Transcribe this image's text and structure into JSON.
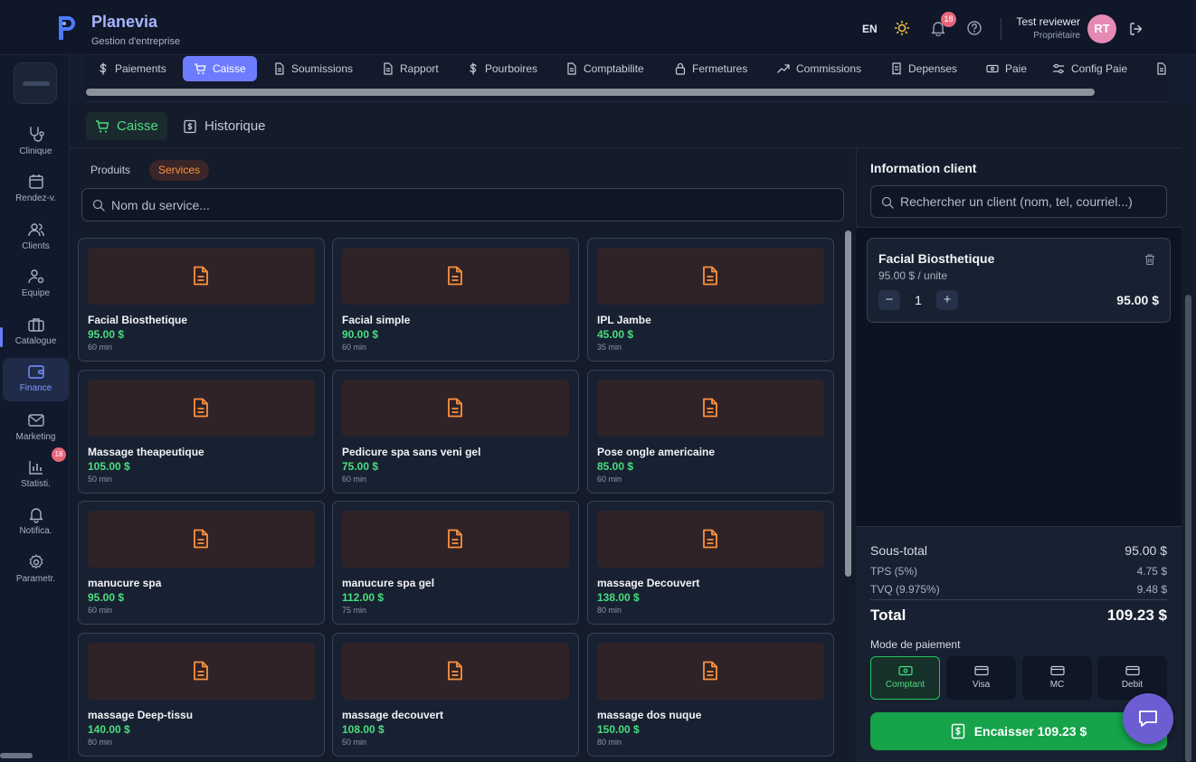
{
  "header": {
    "app_name": "Planevia",
    "app_subtitle": "Gestion d'entreprise",
    "language": "EN",
    "notification_count": "18",
    "user_name": "Test reviewer",
    "user_role": "Propriétaire",
    "user_initials": "RT"
  },
  "sidebar": {
    "items": [
      {
        "label": "Clinique",
        "icon": "stethoscope-icon"
      },
      {
        "label": "Rendez-v.",
        "icon": "calendar-icon"
      },
      {
        "label": "Clients",
        "icon": "users-icon"
      },
      {
        "label": "Equipe",
        "icon": "user-cog-icon"
      },
      {
        "label": "Catalogue",
        "icon": "briefcase-icon"
      },
      {
        "label": "Finance",
        "icon": "wallet-icon"
      },
      {
        "label": "Marketing",
        "icon": "mail-icon"
      },
      {
        "label": "Statisti.",
        "icon": "bar-chart-icon"
      },
      {
        "label": "Notifica.",
        "icon": "bell-icon"
      },
      {
        "label": "Parametr.",
        "icon": "gear-icon"
      }
    ],
    "notification_badge": "18"
  },
  "module_tabs": [
    {
      "label": "Paiements",
      "icon": "dollar-icon"
    },
    {
      "label": "Caisse",
      "icon": "cart-icon"
    },
    {
      "label": "Soumissions",
      "icon": "file-icon"
    },
    {
      "label": "Rapport",
      "icon": "file-icon"
    },
    {
      "label": "Pourboires",
      "icon": "dollar-icon"
    },
    {
      "label": "Comptabilite",
      "icon": "file-icon"
    },
    {
      "label": "Fermetures",
      "icon": "lock-icon"
    },
    {
      "label": "Commissions",
      "icon": "trend-icon"
    },
    {
      "label": "Depenses",
      "icon": "receipt-icon"
    },
    {
      "label": "Paie",
      "icon": "cash-icon"
    },
    {
      "label": "Config Paie",
      "icon": "sliders-icon"
    }
  ],
  "sub_tabs": {
    "caisse": "Caisse",
    "historique": "Historique"
  },
  "catalog": {
    "tab_products": "Produits",
    "tab_services": "Services",
    "search_placeholder": "Nom du service...",
    "services": [
      {
        "name": "Facial Biosthetique",
        "price": "95.00 $",
        "duration": "60 min"
      },
      {
        "name": "Facial simple",
        "price": "90.00 $",
        "duration": "60 min"
      },
      {
        "name": "IPL Jambe",
        "price": "45.00 $",
        "duration": "35 min"
      },
      {
        "name": "Massage theapeutique",
        "price": "105.00 $",
        "duration": "50 min"
      },
      {
        "name": "Pedicure spa sans veni gel",
        "price": "75.00 $",
        "duration": "60 min"
      },
      {
        "name": "Pose ongle americaine",
        "price": "85.00 $",
        "duration": "60 min"
      },
      {
        "name": "manucure spa",
        "price": "95.00 $",
        "duration": "60 min"
      },
      {
        "name": "manucure spa gel",
        "price": "112.00 $",
        "duration": "75 min"
      },
      {
        "name": "massage Decouvert",
        "price": "138.00 $",
        "duration": "80 min"
      },
      {
        "name": "massage Deep-tissu",
        "price": "140.00 $",
        "duration": "80 min"
      },
      {
        "name": "massage decouvert",
        "price": "108.00 $",
        "duration": "50 min"
      },
      {
        "name": "massage dos nuque",
        "price": "150.00 $",
        "duration": "80 min"
      }
    ]
  },
  "client_panel": {
    "title": "Information client",
    "search_placeholder": "Rechercher un client (nom, tel, courriel...)"
  },
  "cart": {
    "items": [
      {
        "name": "Facial Biosthetique",
        "unit_price": "95.00 $ / unite",
        "quantity": "1",
        "total": "95.00 $"
      }
    ]
  },
  "totals": {
    "subtotal_label": "Sous-total",
    "subtotal": "95.00 $",
    "tps_label": "TPS (5%)",
    "tps": "4.75 $",
    "tvq_label": "TVQ (9.975%)",
    "tvq": "9.48 $",
    "total_label": "Total",
    "total": "109.23 $"
  },
  "payment": {
    "title": "Mode de paiement",
    "methods": [
      "Comptant",
      "Visa",
      "MC",
      "Debit"
    ],
    "selected": "Comptant",
    "checkout_label": "Encaisser 109.23 $"
  },
  "colors": {
    "accent": "#6d7cff",
    "success": "#4ade80",
    "service_highlight": "#fb923c",
    "badge": "#e5677a"
  }
}
